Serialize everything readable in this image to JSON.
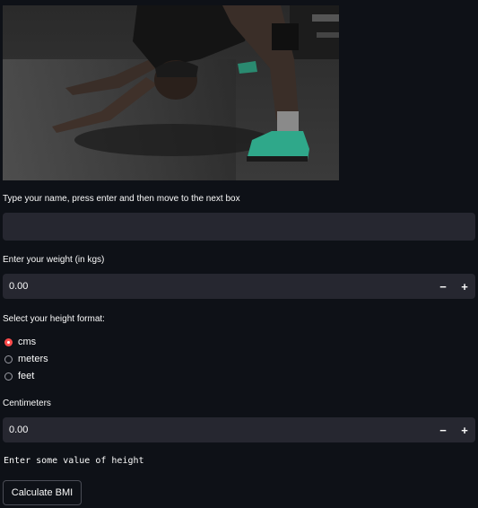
{
  "hero": {
    "image_desc_icon": "person-stretching-photo"
  },
  "name_field": {
    "label": "Type your name, press enter and then move to the next box",
    "value": "",
    "placeholder": ""
  },
  "weight_field": {
    "label": "Enter your weight (in kgs)",
    "value": "0.00",
    "minus_label": "−",
    "plus_label": "+"
  },
  "height_format": {
    "label": "Select your height format:",
    "options": [
      "cms",
      "meters",
      "feet"
    ],
    "selected": "cms"
  },
  "height_field": {
    "label": "Centimeters",
    "value": "0.00",
    "minus_label": "−",
    "plus_label": "+"
  },
  "message": "Enter some value of height",
  "calculate_button": {
    "label": "Calculate BMI"
  },
  "colors": {
    "background": "#0e1117",
    "input_bg": "#262730",
    "accent": "#ff4b4b"
  }
}
